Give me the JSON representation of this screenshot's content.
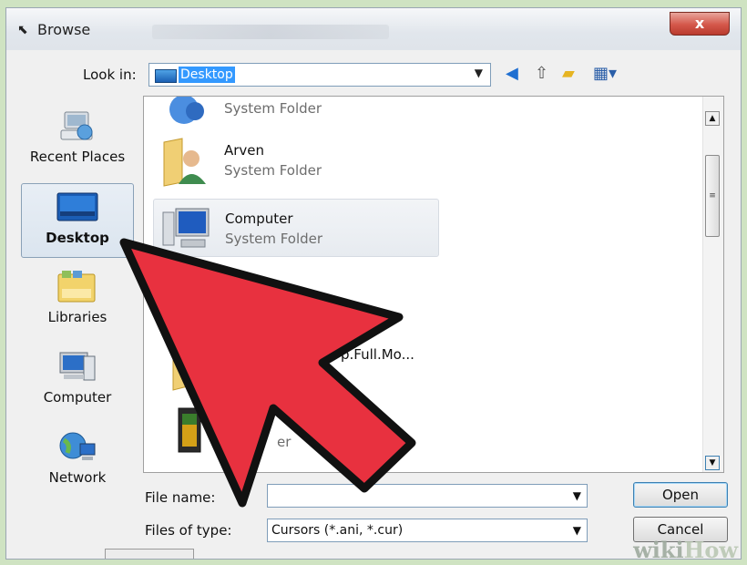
{
  "window": {
    "title": "Browse",
    "close_label": "x"
  },
  "lookin": {
    "label": "Look in:",
    "value": "Desktop"
  },
  "sidebar": {
    "items": [
      {
        "label": "Recent Places",
        "icon": "recent-places-icon"
      },
      {
        "label": "Desktop",
        "icon": "desktop-icon",
        "selected": true
      },
      {
        "label": "Libraries",
        "icon": "libraries-icon"
      },
      {
        "label": "Computer",
        "icon": "computer-icon"
      },
      {
        "label": "Network",
        "icon": "network-icon"
      }
    ]
  },
  "files": [
    {
      "name": "",
      "type": "System Folder"
    },
    {
      "name": "Arven",
      "type": "System Folder"
    },
    {
      "name": "Computer",
      "type": "System Folder",
      "selected": true
    },
    {
      "name": "p.Full.Mo...",
      "type": ""
    },
    {
      "name": "",
      "type": "er"
    }
  ],
  "filename": {
    "label": "File name:",
    "value": ""
  },
  "filetype": {
    "label": "Files of type:",
    "value": "Cursors (*.ani, *.cur)"
  },
  "buttons": {
    "open": "Open",
    "cancel": "Cancel"
  },
  "watermark": {
    "brand_wiki": "wiki",
    "brand_how": "How"
  },
  "colors": {
    "arrow_fill": "#e8313f",
    "arrow_stroke": "#111111",
    "selection": "#3399ff"
  }
}
